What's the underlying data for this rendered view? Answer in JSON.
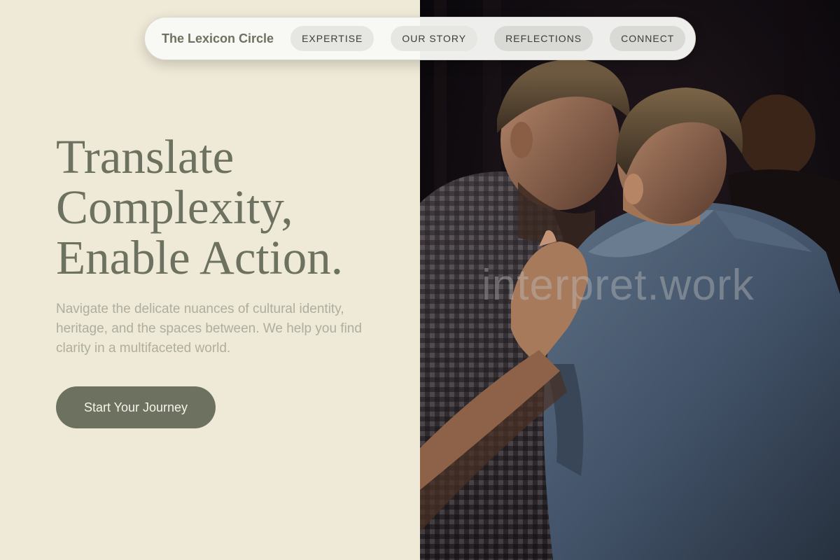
{
  "nav": {
    "brand": "The Lexicon Circle",
    "items": [
      {
        "label": "EXPERTISE"
      },
      {
        "label": "OUR STORY"
      },
      {
        "label": "REFLECTIONS"
      },
      {
        "label": "CONNECT"
      }
    ]
  },
  "hero": {
    "title_lines": [
      "Translate",
      "Complexity,",
      "Enable Action."
    ],
    "subtitle": "Navigate the delicate nuances of cultural identity, heritage, and the spaces between. We help you find clarity in a multifaceted world.",
    "cta_label": "Start Your Journey"
  },
  "image": {
    "watermark": "interpret.work"
  },
  "colors": {
    "background": "#efe9d7",
    "accent": "#6d7260",
    "subtitle": "#aeae9f"
  }
}
